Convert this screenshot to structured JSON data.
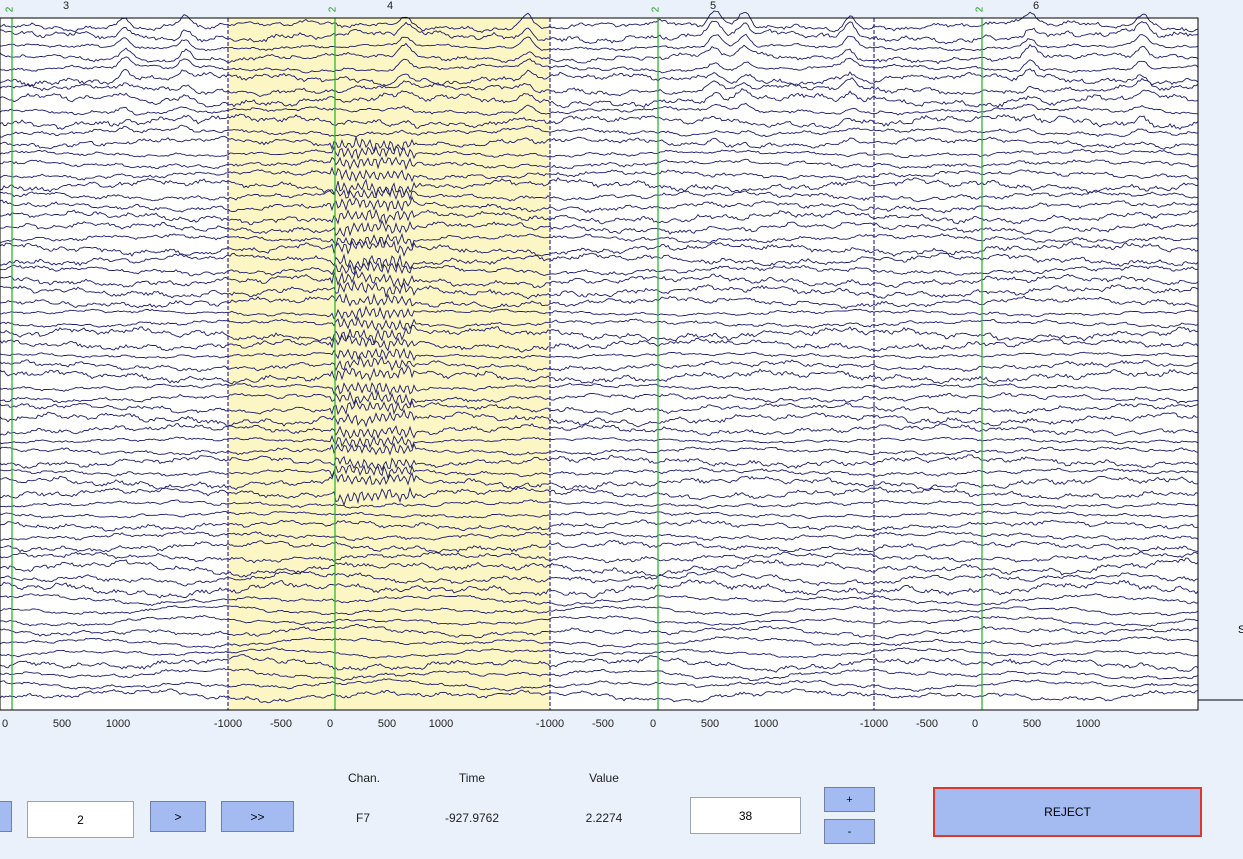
{
  "epochs": [
    {
      "label": "3",
      "event_label": "2"
    },
    {
      "label": "4",
      "event_label": "2",
      "selected": true
    },
    {
      "label": "5",
      "event_label": "2"
    },
    {
      "label": "6",
      "event_label": "2"
    }
  ],
  "x_ticks": [
    "0",
    "500",
    "1000",
    "-1000",
    "-500",
    "0",
    "500",
    "1000",
    "-1000",
    "-500",
    "0",
    "500",
    "1000",
    "-1000",
    "-500",
    "0",
    "500",
    "1000"
  ],
  "colors": {
    "trace": "#1c1c6e",
    "epoch_boundary": "#2d2d9c",
    "event_marker": "#2db82d",
    "selected_epoch": "#fbf6c3",
    "background": "#eaf1fb",
    "reject_border": "#e3362b",
    "button": "#a4bbf2"
  },
  "controls": {
    "prev_button_label": "",
    "epoch_field_value": "2",
    "next_label": ">",
    "fast_next_label": ">>",
    "chan_header": "Chan.",
    "time_header": "Time",
    "value_header": "Value",
    "chan_value": "F7",
    "time_value": "-927.9762",
    "value_value": "2.2274",
    "scale_value": "38",
    "plus_label": "+",
    "minus_label": "-",
    "reject_label": "REJECT"
  },
  "edge_label": "S"
}
